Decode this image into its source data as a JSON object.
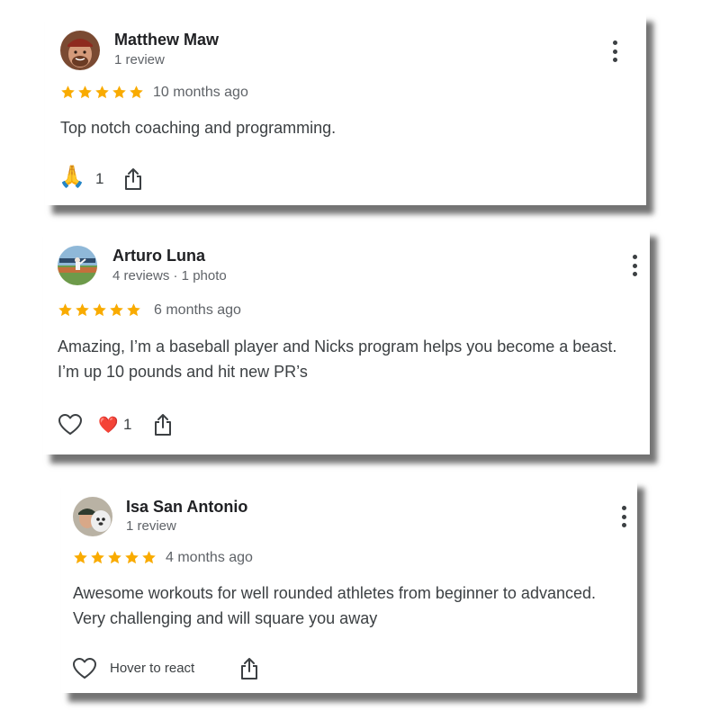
{
  "reviews": [
    {
      "name": "Matthew Maw",
      "meta": "1 review",
      "rating": 5,
      "time": "10 months ago",
      "text": "Top notch coaching and programming.",
      "reaction_emoji": "🙏",
      "reaction_count": "1"
    },
    {
      "name": "Arturo Luna",
      "meta": "4 reviews · 1 photo",
      "rating": 5,
      "time": "6 months ago",
      "text": "Amazing, I’m a baseball player and Nicks program helps you become a beast. I’m up 10 pounds and hit new PR’s",
      "reaction_emoji": "❤️",
      "reaction_count": "1"
    },
    {
      "name": "Isa San Antonio",
      "meta": "1 review",
      "rating": 5,
      "time": "4 months ago",
      "text": "Awesome workouts for well rounded athletes from beginner to advanced. Very challenging and will square you away",
      "hover_label": "Hover to react"
    }
  ],
  "colors": {
    "star": "#f9ab00",
    "text": "#3c4043",
    "muted": "#5f6368"
  },
  "icons": [
    "more-vert-icon",
    "share-icon",
    "heart-outline-icon"
  ]
}
